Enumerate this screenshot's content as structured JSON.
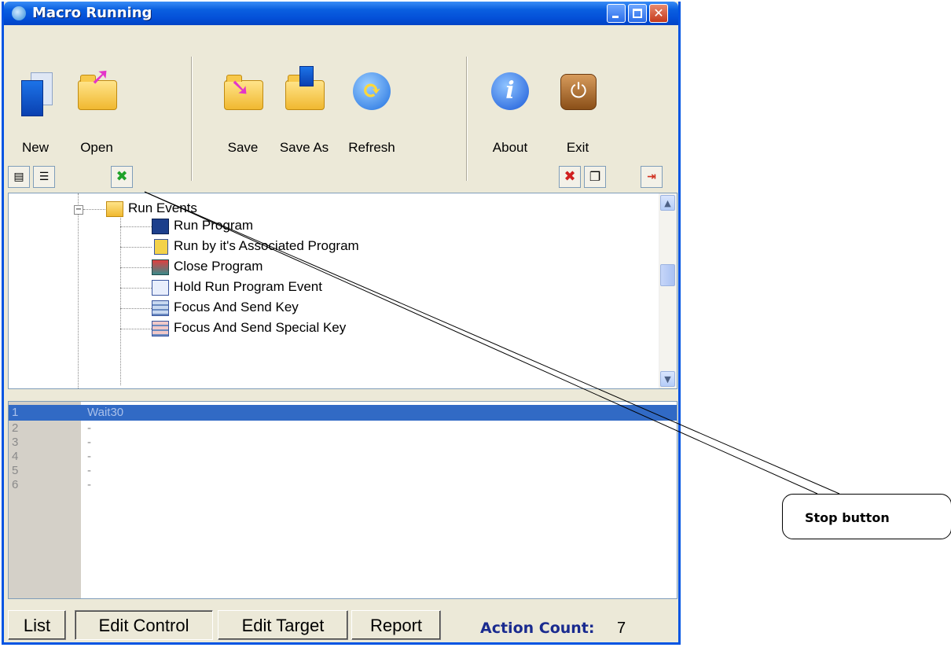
{
  "window": {
    "title": "Macro Running"
  },
  "toolbar": {
    "new_label": "New",
    "open_label": "Open",
    "save_label": "Save",
    "save_as_label": "Save As",
    "refresh_label": "Refresh",
    "about_label": "About",
    "exit_label": "Exit"
  },
  "tree": {
    "parent_label": "Run Events",
    "items": [
      {
        "label": "Run Program",
        "icon": "run-program-icon"
      },
      {
        "label": "Run by it's Associated Program",
        "icon": "associated-program-icon"
      },
      {
        "label": "Close Program",
        "icon": "close-program-icon"
      },
      {
        "label": "Hold Run Program Event",
        "icon": "hold-event-icon"
      },
      {
        "label": "Focus And Send Key",
        "icon": "send-key-icon"
      },
      {
        "label": "Focus And Send Special Key",
        "icon": "send-special-key-icon"
      }
    ]
  },
  "editor": {
    "lines": [
      {
        "no": "1",
        "text": "Wait30"
      },
      {
        "no": "2",
        "text": "-"
      },
      {
        "no": "3",
        "text": "-"
      },
      {
        "no": "4",
        "text": "-"
      },
      {
        "no": "5",
        "text": "-"
      },
      {
        "no": "6",
        "text": "-"
      }
    ]
  },
  "tabs": {
    "list": "List",
    "edit_control": "Edit Control",
    "edit_target": "Edit Target",
    "report": "Report"
  },
  "status": {
    "action_count_label": "Action Count:",
    "action_count_value": "7"
  },
  "annotation": {
    "callout_text": "Stop button"
  },
  "colors": {
    "titlebar": "#0450d8",
    "selection": "#316ac5",
    "count_label": "#1a2b8f"
  }
}
